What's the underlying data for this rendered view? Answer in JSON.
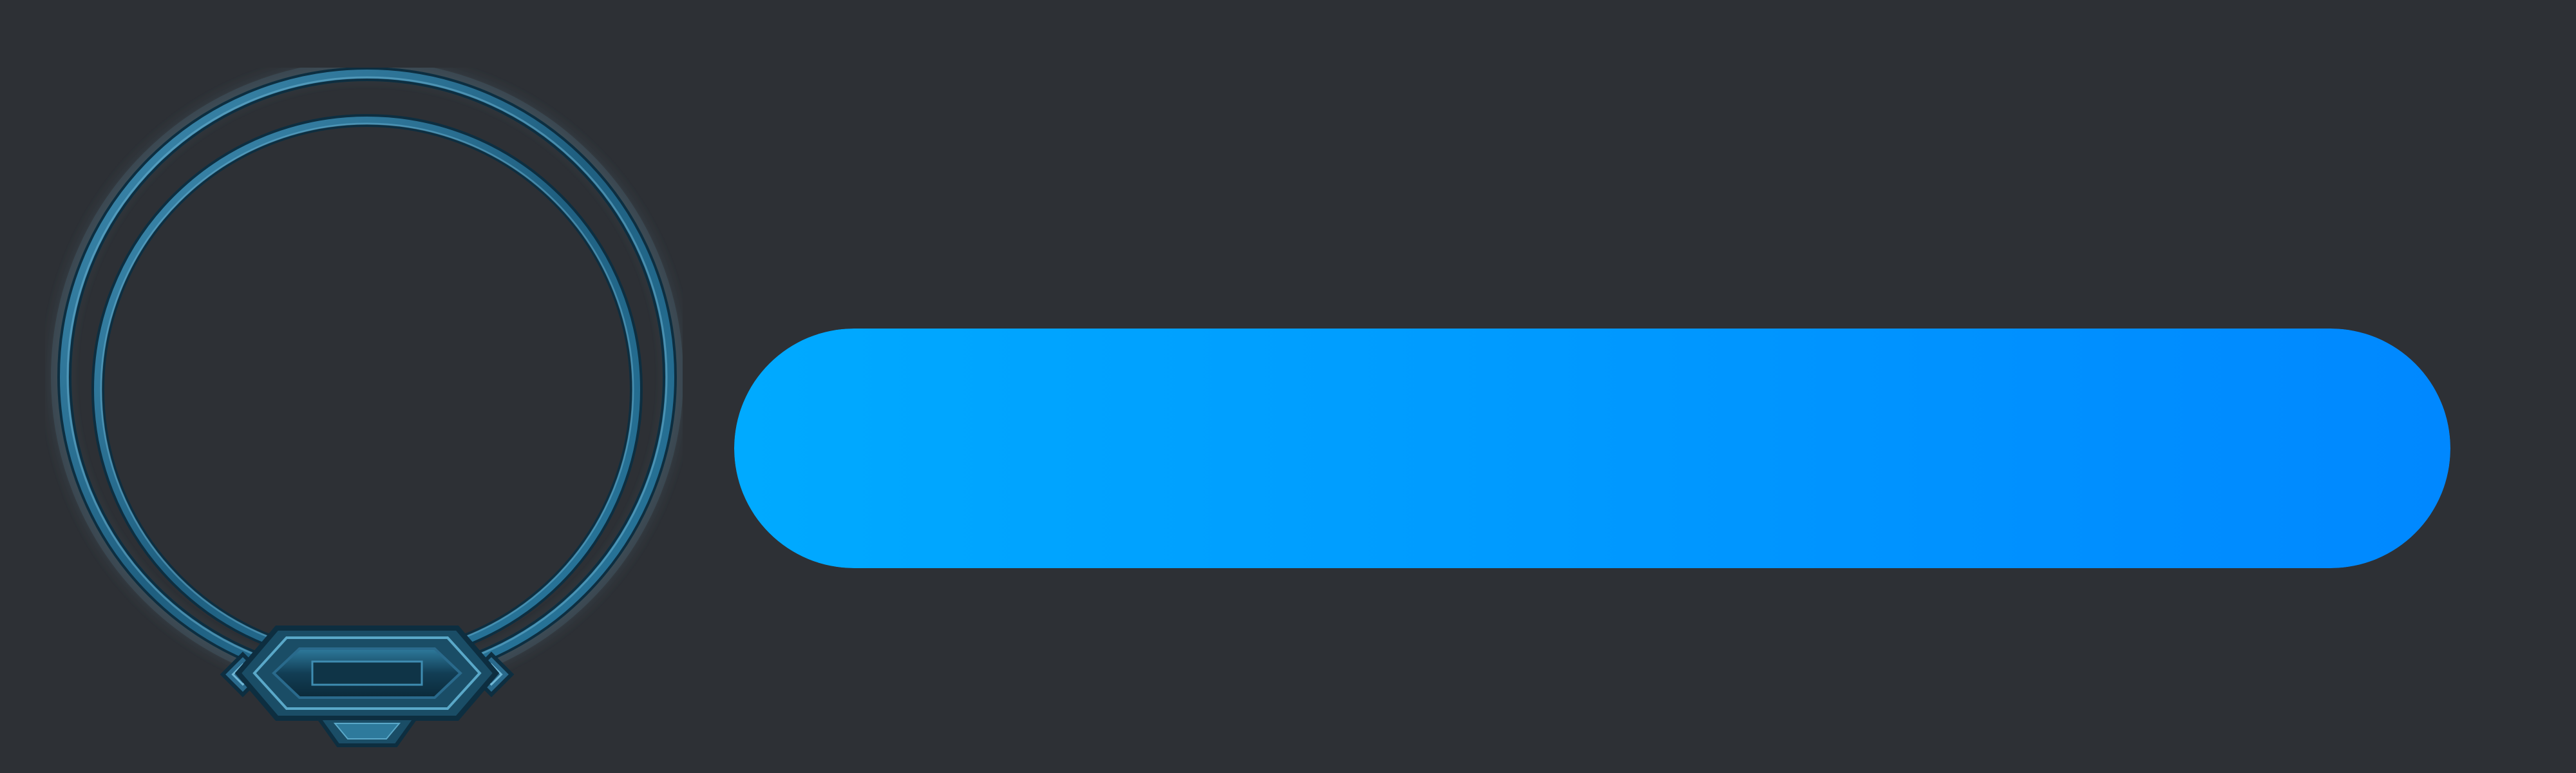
{
  "portrait": {
    "frame_icon": "ornate-circular-portrait-frame",
    "frame_color": "#2a6a8c",
    "frame_highlight": "#5aa8c8",
    "frame_dark": "#0d2e40",
    "slot_empty": true
  },
  "progress_bar": {
    "fraction": 1.0,
    "gradient_start": "#00aaff",
    "gradient_end": "#0088ff"
  },
  "colors": {
    "background": "#2d3035"
  }
}
